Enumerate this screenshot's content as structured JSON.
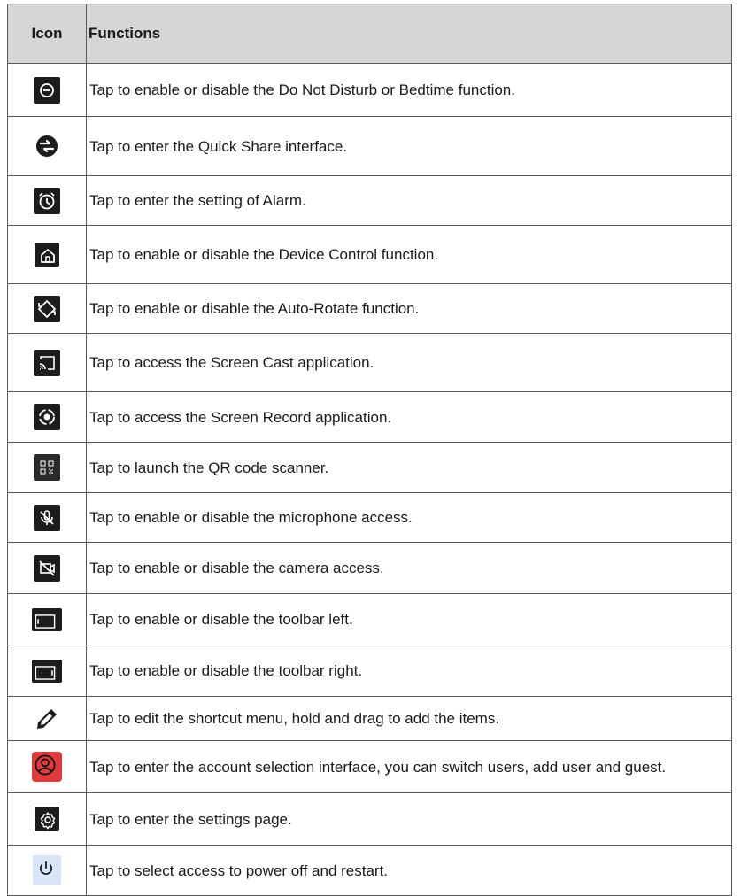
{
  "table": {
    "header": {
      "icon_col": "Icon",
      "functions_col": "Functions"
    },
    "rows": [
      {
        "icon": "do-not-disturb-icon",
        "text": "Tap to enable or disable the Do Not Disturb or Bedtime function."
      },
      {
        "icon": "quick-share-icon",
        "text": "Tap to enter the Quick Share interface."
      },
      {
        "icon": "alarm-icon",
        "text": "Tap to enter the setting of Alarm."
      },
      {
        "icon": "device-control-home-icon",
        "text": "Tap to enable or disable the Device Control function."
      },
      {
        "icon": "auto-rotate-icon",
        "text": "Tap to enable or disable the Auto-Rotate function."
      },
      {
        "icon": "screen-cast-icon",
        "text": "Tap to access the Screen Cast application."
      },
      {
        "icon": "screen-record-icon",
        "text": "Tap to access the Screen Record application."
      },
      {
        "icon": "qr-code-scanner-icon",
        "text": "Tap to launch the QR code scanner."
      },
      {
        "icon": "microphone-off-icon",
        "text": "Tap to enable or disable the microphone access."
      },
      {
        "icon": "camera-off-icon",
        "text": "Tap to enable or disable the camera access."
      },
      {
        "icon": "toolbar-left-icon",
        "text": "Tap to enable or disable the toolbar left."
      },
      {
        "icon": "toolbar-right-icon",
        "text": "Tap to enable or disable the toolbar right."
      },
      {
        "icon": "edit-pencil-icon",
        "text": "Tap to edit the shortcut menu, hold and drag to add the items."
      },
      {
        "icon": "account-user-icon",
        "text": "Tap to enter the account selection interface, you can switch users, add user and guest."
      },
      {
        "icon": "settings-gear-icon",
        "text": "Tap to enter the settings page."
      },
      {
        "icon": "power-icon",
        "text": "Tap to select access to  power off and restart."
      }
    ]
  }
}
